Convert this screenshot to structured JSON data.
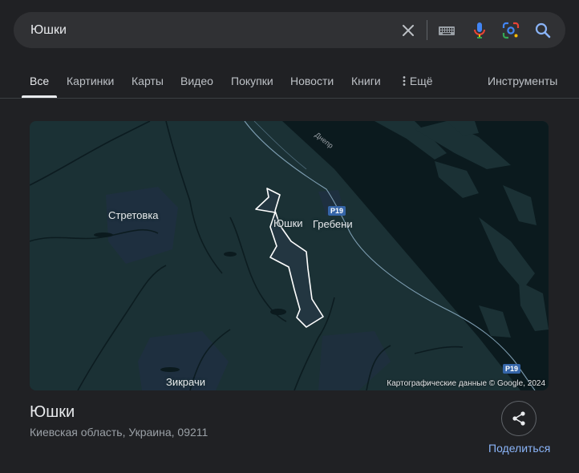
{
  "search": {
    "query": "Юшки",
    "icons": [
      "close-icon",
      "keyboard-icon",
      "microphone-icon",
      "lens-icon",
      "search-icon"
    ]
  },
  "tabs": {
    "items": [
      {
        "label": "Все",
        "active": true
      },
      {
        "label": "Картинки"
      },
      {
        "label": "Карты"
      },
      {
        "label": "Видео"
      },
      {
        "label": "Покупки"
      },
      {
        "label": "Новости"
      },
      {
        "label": "Книги"
      },
      {
        "label": "Ещё",
        "icon": "more-vert-icon"
      }
    ],
    "tools_label": "Инструменты"
  },
  "map": {
    "labels": {
      "stretovka": "Стретовка",
      "yushki": "Юшки",
      "grebeni": "Гребени",
      "zikrachi": "Зикрачи",
      "river": "Днепр"
    },
    "road_badges": [
      "P19",
      "P19"
    ],
    "attribution": "Картографические данные © Google, 2024",
    "colors": {
      "land": "#1b3135",
      "water": "#0a1a1e",
      "border": "#ffffff"
    }
  },
  "place": {
    "title": "Юшки",
    "subtitle": "Киевская область, Украина, 09211",
    "share_label": "Поделиться"
  }
}
